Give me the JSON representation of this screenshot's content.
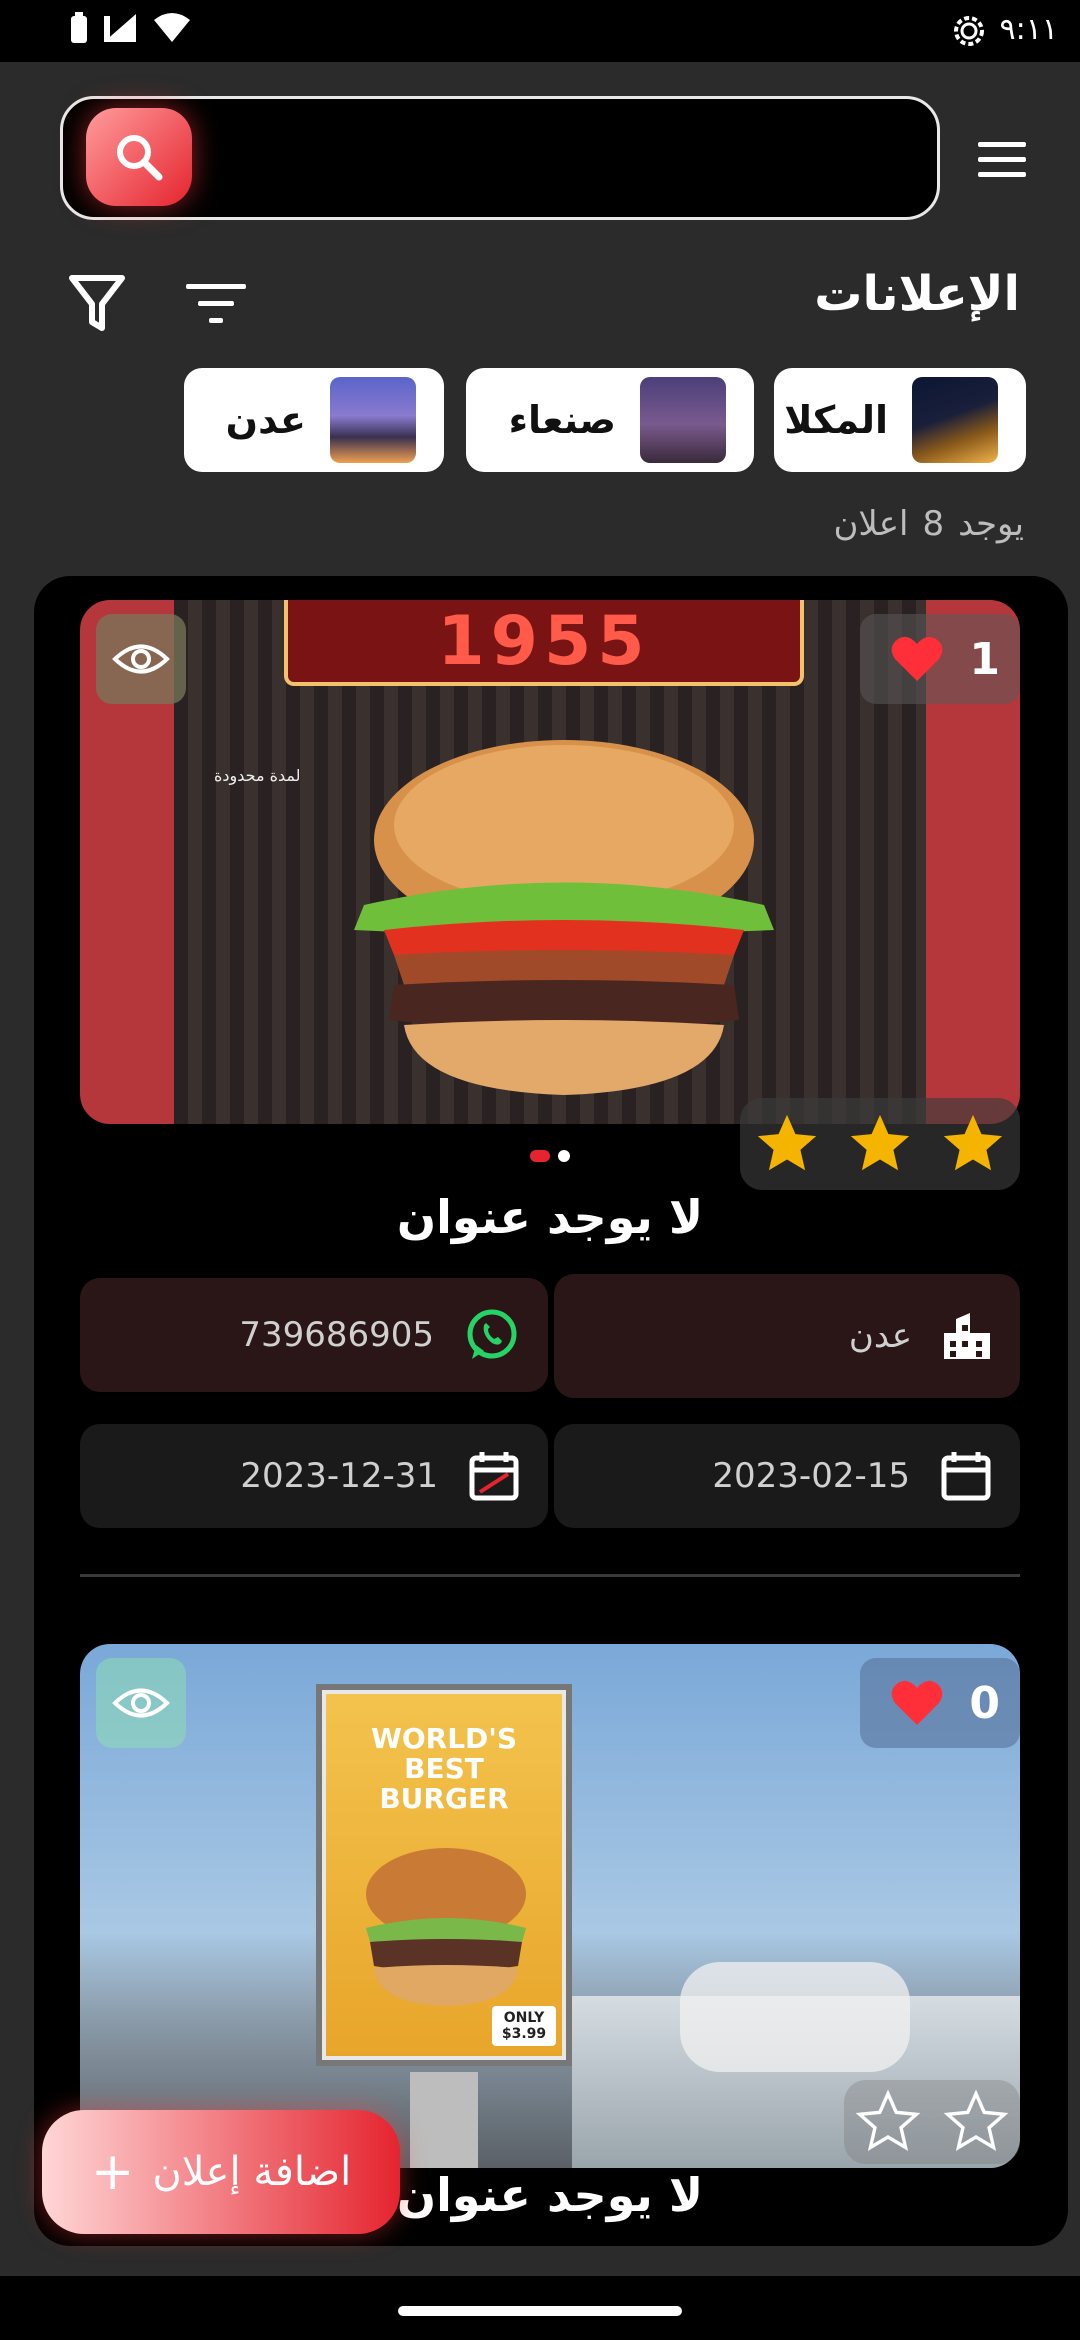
{
  "status_bar": {
    "time": "٩:١١"
  },
  "search": {
    "placeholder": ""
  },
  "header": {
    "title": "الإعلانات"
  },
  "cities": [
    {
      "label": "المكلا"
    },
    {
      "label": "صنعاء"
    },
    {
      "label": "عدن"
    }
  ],
  "count": {
    "prefix": "يوجد",
    "number": "8",
    "suffix": "اعلان"
  },
  "ads": [
    {
      "title": "لا يوجد عنوان",
      "likes": "1",
      "rating": 3,
      "banner_text": "1955",
      "caption": "لمدة محدودة",
      "phone": "739686905",
      "city": "عدن",
      "start_date": "2023-02-15",
      "end_date": "2023-12-31"
    },
    {
      "title": "لا يوجد عنوان",
      "likes": "0",
      "rating": 0,
      "billboard_lines": [
        "WORLD'S",
        "BEST",
        "BURGER"
      ],
      "price_tag": "ONLY $3.99"
    }
  ],
  "fab": {
    "label": "اضافة إعلان",
    "icon": "plus-icon"
  },
  "colors": {
    "accent": "#e5242f",
    "background": "#2b2b2b",
    "panel": "#000000",
    "star": "#f4b400",
    "whatsapp": "#25d366"
  }
}
